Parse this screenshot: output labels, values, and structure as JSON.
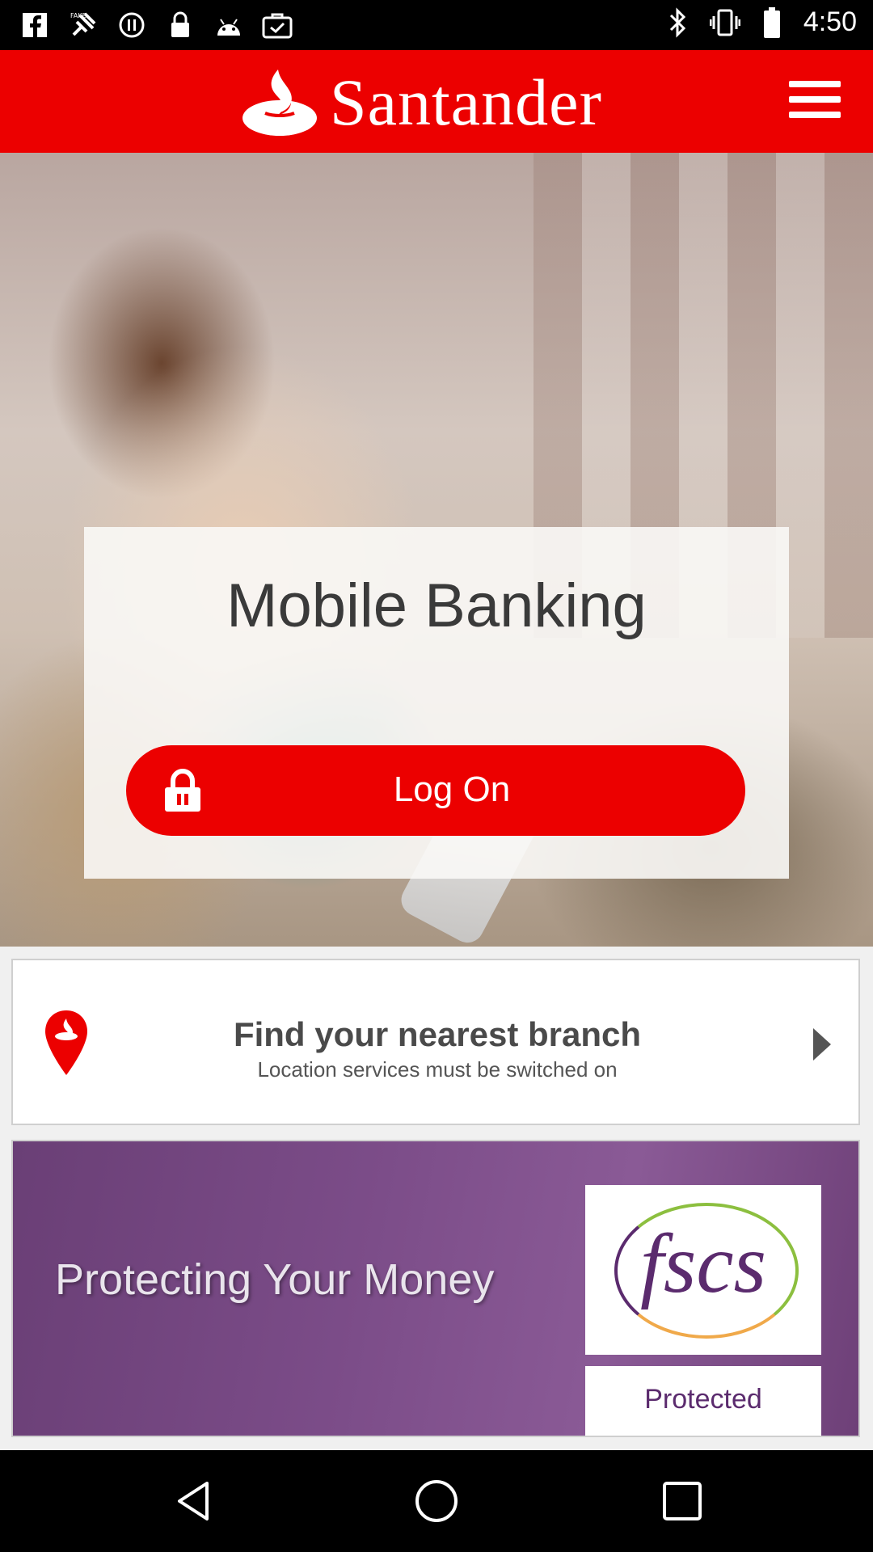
{
  "status_bar": {
    "time": "4:50",
    "left_icons": [
      "facebook-icon",
      "fake-gps-icon",
      "pause-circle-icon",
      "lock-icon",
      "android-icon",
      "briefcase-check-icon"
    ],
    "right_icons": [
      "bluetooth-icon",
      "vibrate-icon",
      "battery-icon"
    ]
  },
  "header": {
    "brand": "Santander",
    "logo_icon": "santander-flame-icon",
    "menu_icon": "hamburger-menu-icon",
    "brand_color": "#ec0000"
  },
  "hero": {
    "title": "Mobile Banking",
    "login_button": "Log On",
    "login_icon": "padlock-icon"
  },
  "branch": {
    "title": "Find your nearest branch",
    "subtitle": "Location services must be switched on",
    "pin_icon": "location-pin-icon",
    "arrow_icon": "chevron-right-icon"
  },
  "fscs_banner": {
    "headline": "Protecting Your Money",
    "logo_text": "fscs",
    "protected_label": "Protected",
    "banner_color": "#7b4c88"
  },
  "nav_bar": {
    "icons": [
      "back-icon",
      "home-icon",
      "recents-icon"
    ]
  }
}
